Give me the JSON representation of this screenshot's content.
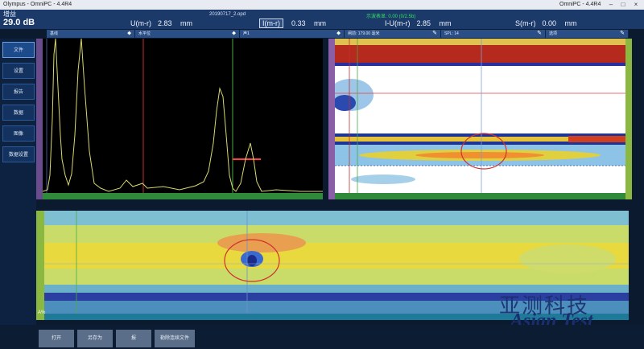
{
  "window": {
    "title": "Olympus - OmniPC - 4.4R4",
    "title_right": "OmniPC - 4.4R4"
  },
  "readings": {
    "gain_label": "增益",
    "gain_value": "29.0 dB",
    "file_name": "20190717_2.opd",
    "status_text": "示波表显: 0.00 (0/2.5b)",
    "u": {
      "label": "U(m-r)",
      "value": "2.83",
      "unit": "mm"
    },
    "i": {
      "label": "I(m-r)",
      "value": "0.33",
      "unit": "mm"
    },
    "iu": {
      "label": "I-U(m-r)",
      "value": "2.85",
      "unit": "mm"
    },
    "s": {
      "label": "S(m-r)",
      "value": "0.00",
      "unit": "mm"
    }
  },
  "controls": [
    {
      "label": "基线"
    },
    {
      "label": "水平位"
    },
    {
      "label": "声1"
    },
    {
      "label": "闸前: 179.00 毫米"
    },
    {
      "label": "SPL: 14"
    },
    {
      "label": "选项"
    }
  ],
  "sidebar": [
    {
      "label": "文件"
    },
    {
      "label": "设置"
    },
    {
      "label": "报告"
    },
    {
      "label": "数据"
    },
    {
      "label": "图像"
    },
    {
      "label": "数据设置"
    }
  ],
  "bottom": {
    "corner_label": "A%",
    "buttons": [
      {
        "label": "打开"
      },
      {
        "label": "另存为"
      },
      {
        "label": "报"
      },
      {
        "label": "勒除连续文件"
      }
    ]
  },
  "watermark": {
    "cn": "亚测科技",
    "en": "Asian Test"
  }
}
